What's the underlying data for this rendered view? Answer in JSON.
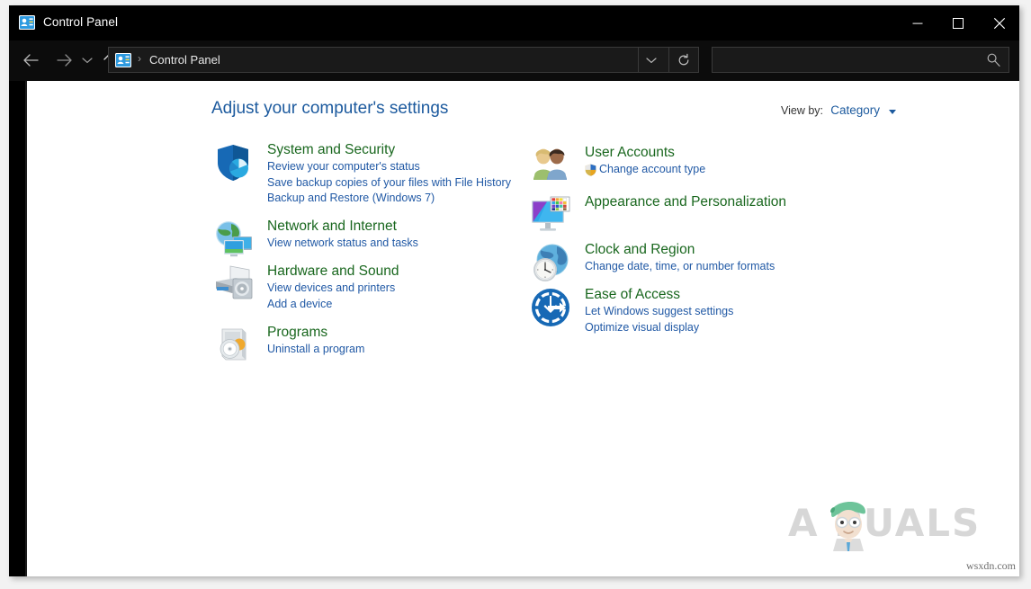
{
  "window": {
    "title": "Control Panel",
    "title_icon": "control-panel-icon",
    "buttons": {
      "minimize": "minimize-icon",
      "maximize": "maximize-icon",
      "close": "close-icon"
    }
  },
  "nav": {
    "back": "back-arrow-icon",
    "forward": "forward-arrow-icon",
    "recent": "chevron-down-icon",
    "up": "up-arrow-icon",
    "address": {
      "icon": "control-panel-icon",
      "separator": "›",
      "path": "Control Panel",
      "dropdown": "chevron-down-icon",
      "refresh": "refresh-icon"
    },
    "search": {
      "value": "",
      "placeholder": "",
      "icon": "search-icon"
    }
  },
  "main": {
    "page_title": "Adjust your computer's settings",
    "view_by_label": "View by:",
    "view_by_value": "Category",
    "view_by_caret": "caret-down-icon",
    "left_column": [
      {
        "icon": "shield-system-security-icon",
        "title": "System and Security",
        "links": [
          {
            "text": "Review your computer's status",
            "shield": false
          },
          {
            "text": "Save backup copies of your files with File History",
            "shield": false
          },
          {
            "text": "Backup and Restore (Windows 7)",
            "shield": false
          }
        ]
      },
      {
        "icon": "network-internet-icon",
        "title": "Network and Internet",
        "links": [
          {
            "text": "View network status and tasks",
            "shield": false
          }
        ]
      },
      {
        "icon": "hardware-sound-icon",
        "title": "Hardware and Sound",
        "links": [
          {
            "text": "View devices and printers",
            "shield": false
          },
          {
            "text": "Add a device",
            "shield": false
          }
        ]
      },
      {
        "icon": "programs-icon",
        "title": "Programs",
        "links": [
          {
            "text": "Uninstall a program",
            "shield": false
          }
        ]
      }
    ],
    "right_column": [
      {
        "icon": "user-accounts-icon",
        "title": "User Accounts",
        "links": [
          {
            "text": "Change account type",
            "shield": true
          }
        ]
      },
      {
        "icon": "appearance-personalization-icon",
        "title": "Appearance and Personalization",
        "links": []
      },
      {
        "icon": "clock-region-icon",
        "title": "Clock and Region",
        "links": [
          {
            "text": "Change date, time, or number formats",
            "shield": false
          }
        ]
      },
      {
        "icon": "ease-of-access-icon",
        "title": "Ease of Access",
        "links": [
          {
            "text": "Let Windows suggest settings",
            "shield": false
          },
          {
            "text": "Optimize visual display",
            "shield": false
          }
        ]
      }
    ]
  },
  "watermark": {
    "brand": "APPUALS",
    "brand_display": "A  PUALS",
    "face_icon": "appuals-mascot-icon",
    "footer": "wsxdn.com"
  },
  "colors": {
    "title_blue": "#1c5a9e",
    "category_green": "#19671e",
    "link_blue": "#2159a5",
    "chrome_black": "#000000",
    "accent_red": "#5a1630"
  }
}
